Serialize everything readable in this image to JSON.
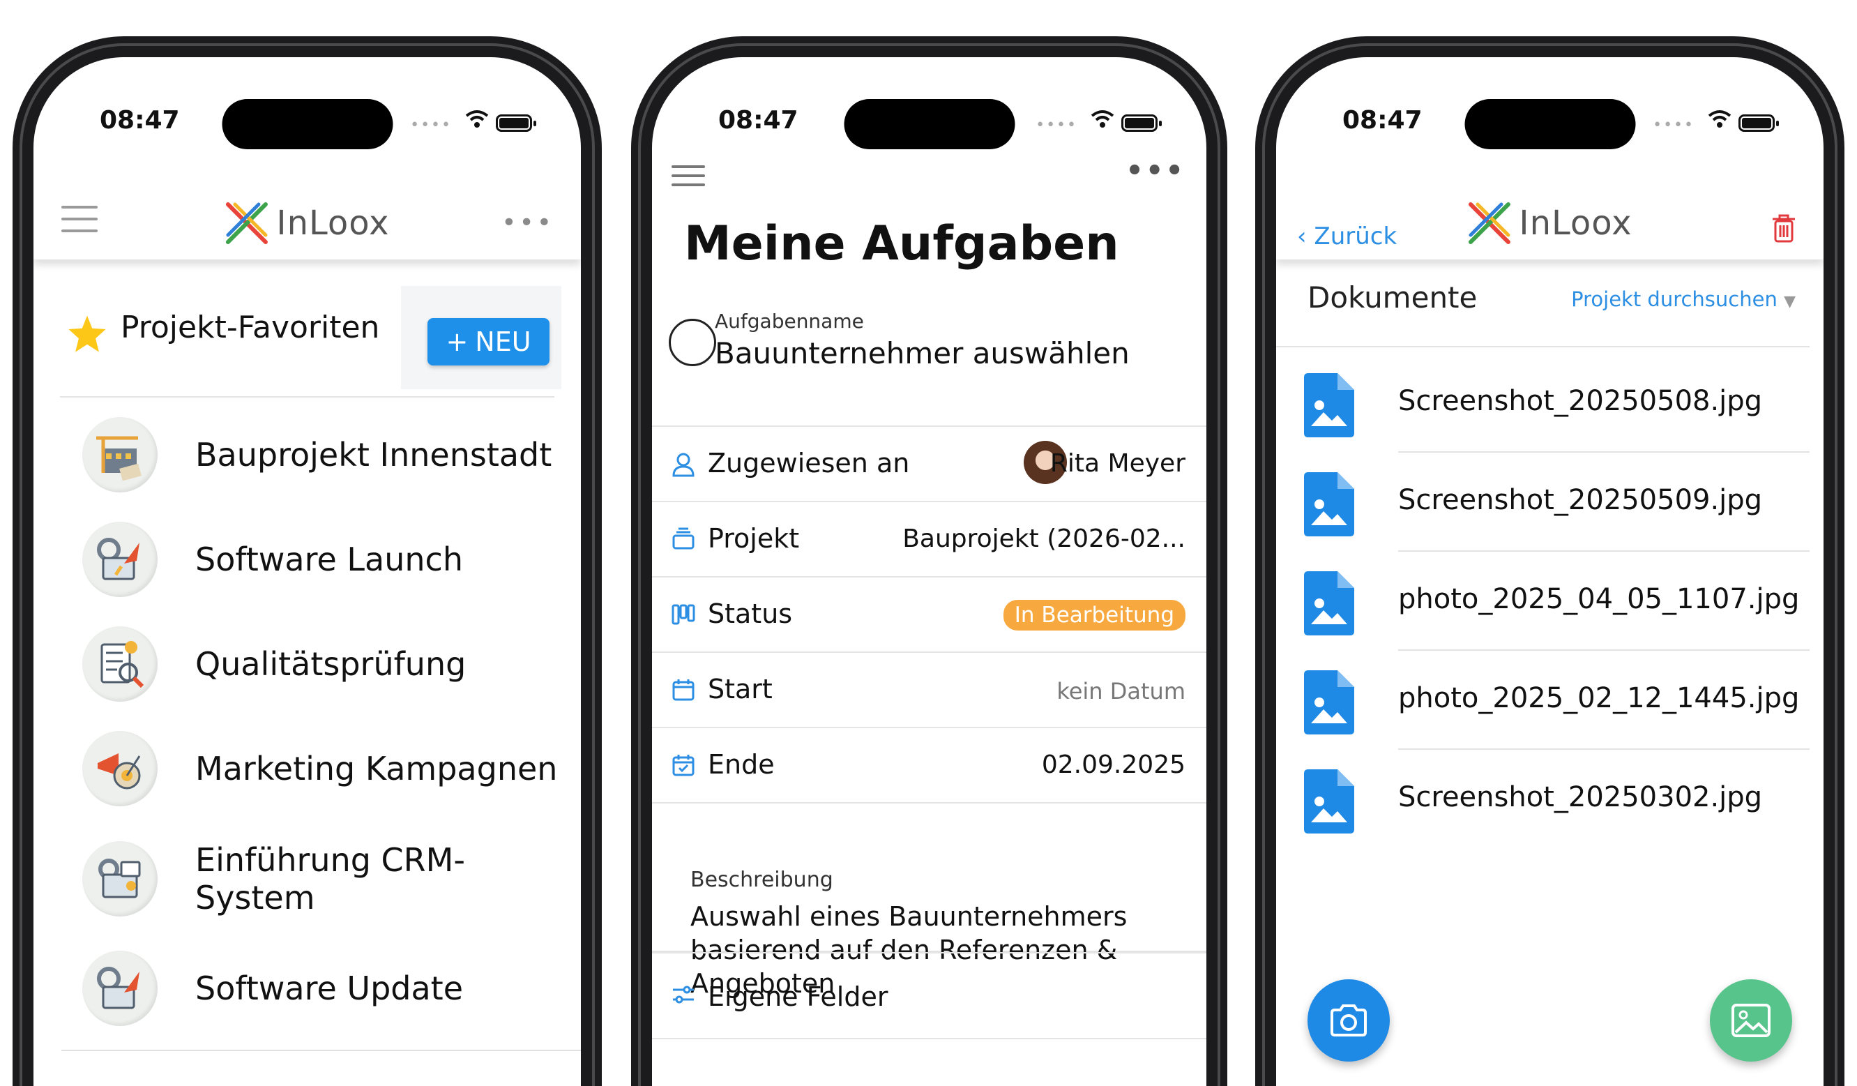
{
  "status": {
    "time": "08:47"
  },
  "phone1": {
    "brand": "InLoox",
    "favorites_title": "Projekt-Favoriten",
    "new_button": "NEU",
    "projects": [
      {
        "label": "Bauprojekt Innenstadt"
      },
      {
        "label": "Software Launch"
      },
      {
        "label": "Qualitätsprüfung"
      },
      {
        "label": "Marketing Kampagnen"
      },
      {
        "label": "Einführung CRM-System"
      },
      {
        "label": "Software Update"
      }
    ]
  },
  "phone2": {
    "title": "Meine Aufgaben",
    "task_caption": "Aufgabenname",
    "task_name": "Bauunternehmer auswählen",
    "rows": {
      "assigned": {
        "label": "Zugewiesen an",
        "value": "Rita Meyer"
      },
      "project": {
        "label": "Projekt",
        "value": "Bauprojekt (2026-02..."
      },
      "status": {
        "label": "Status",
        "value": "In Bearbeitung"
      },
      "start": {
        "label": "Start",
        "value": "kein Datum"
      },
      "end": {
        "label": "Ende",
        "value": "02.09.2025"
      },
      "custom": {
        "label": "Eigene Felder"
      }
    },
    "description_caption": "Beschreibung",
    "description": "Auswahl eines Bauunternehmers basierend auf den Referenzen & Angeboten"
  },
  "phone3": {
    "back": "Zurück",
    "brand": "InLoox",
    "section_title": "Dokumente",
    "search_label": "Projekt durchsuchen",
    "files": [
      {
        "name": "Screenshot_20250508.jpg"
      },
      {
        "name": "Screenshot_20250509.jpg"
      },
      {
        "name": "photo_2025_04_05_1107.jpg"
      },
      {
        "name": "photo_2025_02_12_1445.jpg"
      },
      {
        "name": "Screenshot_20250302.jpg"
      }
    ]
  },
  "colors": {
    "accent": "#1e90ea",
    "status_badge": "#f7a93f",
    "delete": "#e0393e",
    "fab_gallery": "#57c48b"
  }
}
